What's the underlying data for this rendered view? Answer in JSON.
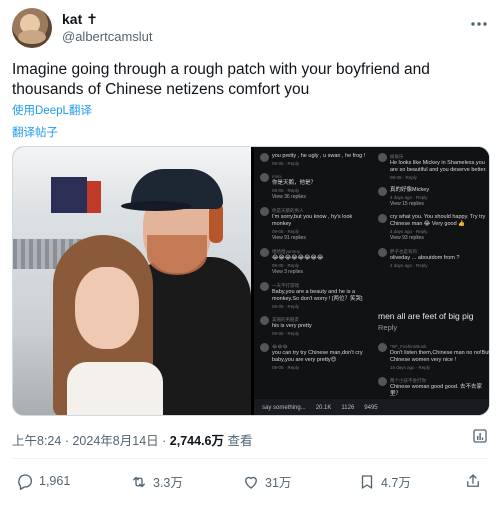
{
  "author": {
    "name": "kat",
    "name_symbol": "✝",
    "handle": "@albertcamslut"
  },
  "more_icon": "more-icon",
  "tweet": {
    "text": "Imagine going through a rough patch with your boyfriend and thousands of Chinese netizens comfort you",
    "translate_deepl": "使用DeepL翻译",
    "translate_post": "翻译帖子"
  },
  "media": {
    "chat_left": [
      {
        "text": "you pretty , he ugly , u swan , he frog !",
        "meta": "09-05 · Reply"
      },
      {
        "user": "mimi",
        "text": "你是天鹅，他是？",
        "meta": "09-05 · Reply",
        "replies": "View 36 replies"
      },
      {
        "user": "他是天鹅的男人",
        "text": "I'm sorry,but you know , hy's look monkey",
        "meta": "09-05 · Reply",
        "replies": "View 91 replies"
      },
      {
        "user": "哈哈哈yummy",
        "text": "😂😂😂😂😂😂😂😂",
        "meta": "09-05 · Reply",
        "replies": "View 3 replies"
      },
      {
        "user": "一天不打游戏",
        "text": "Baby,you are a beauty and he is a monkey.So don't worry ! [两位？笑哭]",
        "meta": "09-05 · Reply"
      },
      {
        "user": "美丽的男朋友",
        "text": "his is very pretty",
        "meta": "09-05 · Reply"
      },
      {
        "user": "😂😂😂",
        "text": "you can try try Chinese man,don't cry baby,you are very pretty😍",
        "meta": "09-05 · Reply"
      }
    ],
    "chat_right": [
      {
        "user": "偷偷乐",
        "text": "He looks like Mickey in Shameless.you are so beautiful and you deserve better.",
        "meta": "09-05 · Reply"
      },
      {
        "user": "",
        "text": "真的好像Mickey",
        "meta": "4 days ago · Reply",
        "replies": "View 15 replies"
      },
      {
        "user": "",
        "text": "cry what you. You should happy. Try try Chinese man 😂 Very good 👍",
        "meta": "4 days ago · Reply",
        "replies": "View 93 replies"
      },
      {
        "user": "胖子也是有的",
        "text": "oliveday ... aboutdom from ?",
        "meta": "4 days ago · Reply"
      }
    ],
    "big_comment": "men all are feet of big pig",
    "big_reply": "Reply",
    "chat_right_bottom": [
      {
        "user": "*W*_FashionBook",
        "text": "Don't listen them,Chinese man no no!But Chinese women very nice ! ",
        "meta": "15 days ago · Reply"
      },
      {
        "user": "两个小孩不会打你",
        "text": "Chinese woman good good. 去不去家里？",
        "meta": "15 days ago · Reply"
      }
    ],
    "chat_bar": [
      "say something...",
      "20.1K",
      "1126",
      "9495"
    ]
  },
  "timestamp": {
    "time": "上午8:24",
    "separator": "·",
    "date": "2024年8月14日",
    "views": "2,744.6万",
    "views_label": "查看"
  },
  "actions": {
    "replies": "1,961",
    "reposts": "3.3万",
    "likes": "31万",
    "bookmarks": "4.7万"
  },
  "colors": {
    "link": "#1d9bf0",
    "muted": "#536471",
    "text": "#0f1419"
  }
}
